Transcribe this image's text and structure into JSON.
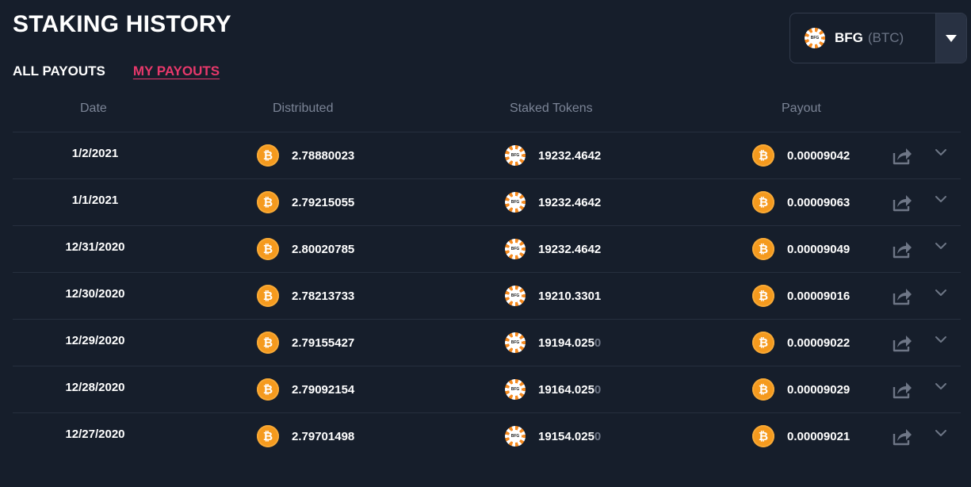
{
  "page": {
    "title": "STAKING HISTORY"
  },
  "tabs": [
    {
      "label": "ALL PAYOUTS",
      "active": false
    },
    {
      "label": "MY PAYOUTS",
      "active": true
    }
  ],
  "selector": {
    "symbol": "BFG",
    "pair": "(BTC)",
    "icon": "bfg-coin-icon",
    "caret_icon": "caret-down-icon"
  },
  "table": {
    "columns": [
      "Date",
      "Distributed",
      "Staked Tokens",
      "Payout"
    ],
    "rows": [
      {
        "date": "1/2/2021",
        "distributed": "2.78880023",
        "staked": "19232.4642",
        "staked_main": "19232.4642",
        "staked_fade": "",
        "payout": "0.00009042"
      },
      {
        "date": "1/1/2021",
        "distributed": "2.79215055",
        "staked": "19232.4642",
        "staked_main": "19232.4642",
        "staked_fade": "",
        "payout": "0.00009063"
      },
      {
        "date": "12/31/2020",
        "distributed": "2.80020785",
        "staked": "19232.4642",
        "staked_main": "19232.4642",
        "staked_fade": "",
        "payout": "0.00009049"
      },
      {
        "date": "12/30/2020",
        "distributed": "2.78213733",
        "staked": "19210.3301",
        "staked_main": "19210.3301",
        "staked_fade": "",
        "payout": "0.00009016"
      },
      {
        "date": "12/29/2020",
        "distributed": "2.79155427",
        "staked": "19194.0250",
        "staked_main": "19194.025",
        "staked_fade": "0",
        "payout": "0.00009022"
      },
      {
        "date": "12/28/2020",
        "distributed": "2.79092154",
        "staked": "19164.0250",
        "staked_main": "19164.025",
        "staked_fade": "0",
        "payout": "0.00009029"
      },
      {
        "date": "12/27/2020",
        "distributed": "2.79701498",
        "staked": "19154.0250",
        "staked_main": "19154.025",
        "staked_fade": "0",
        "payout": "0.00009021"
      }
    ],
    "icons": {
      "distributed": "bitcoin-icon",
      "staked": "bfg-coin-icon",
      "payout": "bitcoin-icon",
      "share": "share-icon",
      "expand": "chevron-down-icon"
    }
  },
  "colors": {
    "background": "#161e2b",
    "accent": "#e8386b",
    "btc": "#f59a1e",
    "muted": "#7b8496"
  }
}
